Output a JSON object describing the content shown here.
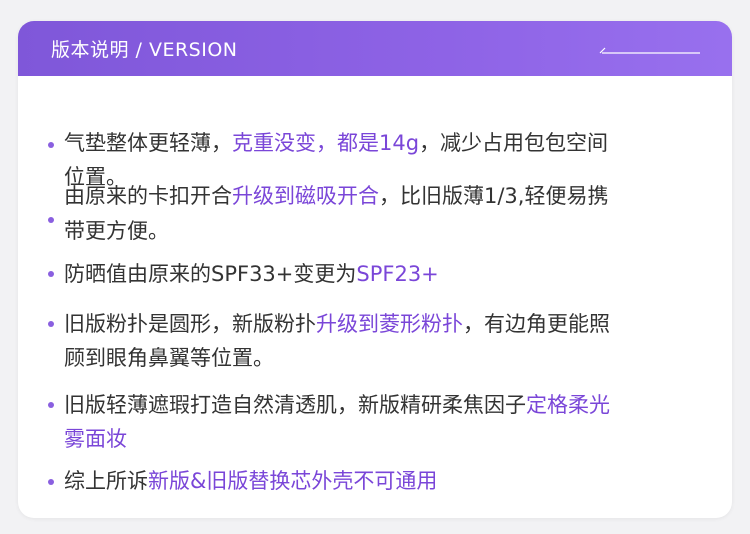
{
  "header": {
    "title": "版本说明 / VERSION"
  },
  "colors": {
    "header_gradient_start": "#7f57d9",
    "header_gradient_end": "#9870ee",
    "highlight": "#7a46d8",
    "text": "#333333",
    "bullet": "#8a5fe0"
  },
  "items": [
    {
      "line1": [
        {
          "t": "气垫整体更轻薄，",
          "h": false
        },
        {
          "t": "克重没变，都是14g",
          "h": true
        },
        {
          "t": "，减少占用包包空间",
          "h": false
        }
      ],
      "line2": [
        {
          "t": "位置。",
          "h": false
        }
      ]
    },
    {
      "line1": [
        {
          "t": "由原来的卡扣开合",
          "h": false
        },
        {
          "t": "升级到磁吸开合",
          "h": true
        },
        {
          "t": "，比旧版薄1/3,轻便易携",
          "h": false
        }
      ],
      "line2": [
        {
          "t": "带更方便。",
          "h": false
        }
      ]
    },
    {
      "line1": [
        {
          "t": "防晒值由原来的SPF33+变更为",
          "h": false
        },
        {
          "t": "SPF23+",
          "h": true
        }
      ]
    },
    {
      "line1": [
        {
          "t": "旧版粉扑是圆形，新版粉扑",
          "h": false
        },
        {
          "t": "升级到菱形粉扑",
          "h": true
        },
        {
          "t": "，有边角更能照",
          "h": false
        }
      ],
      "line2": [
        {
          "t": "顾到眼角鼻翼等位置。",
          "h": false
        }
      ]
    },
    {
      "line1": [
        {
          "t": "旧版轻薄遮瑕打造自然清透肌，新版精研柔焦因子",
          "h": false
        },
        {
          "t": "定格柔光",
          "h": true
        }
      ],
      "line2": [
        {
          "t": "雾面妆",
          "h": true
        }
      ]
    },
    {
      "line1": [
        {
          "t": "综上所诉",
          "h": false
        },
        {
          "t": "新版&旧版替换芯外壳不可通用",
          "h": true
        }
      ]
    }
  ]
}
